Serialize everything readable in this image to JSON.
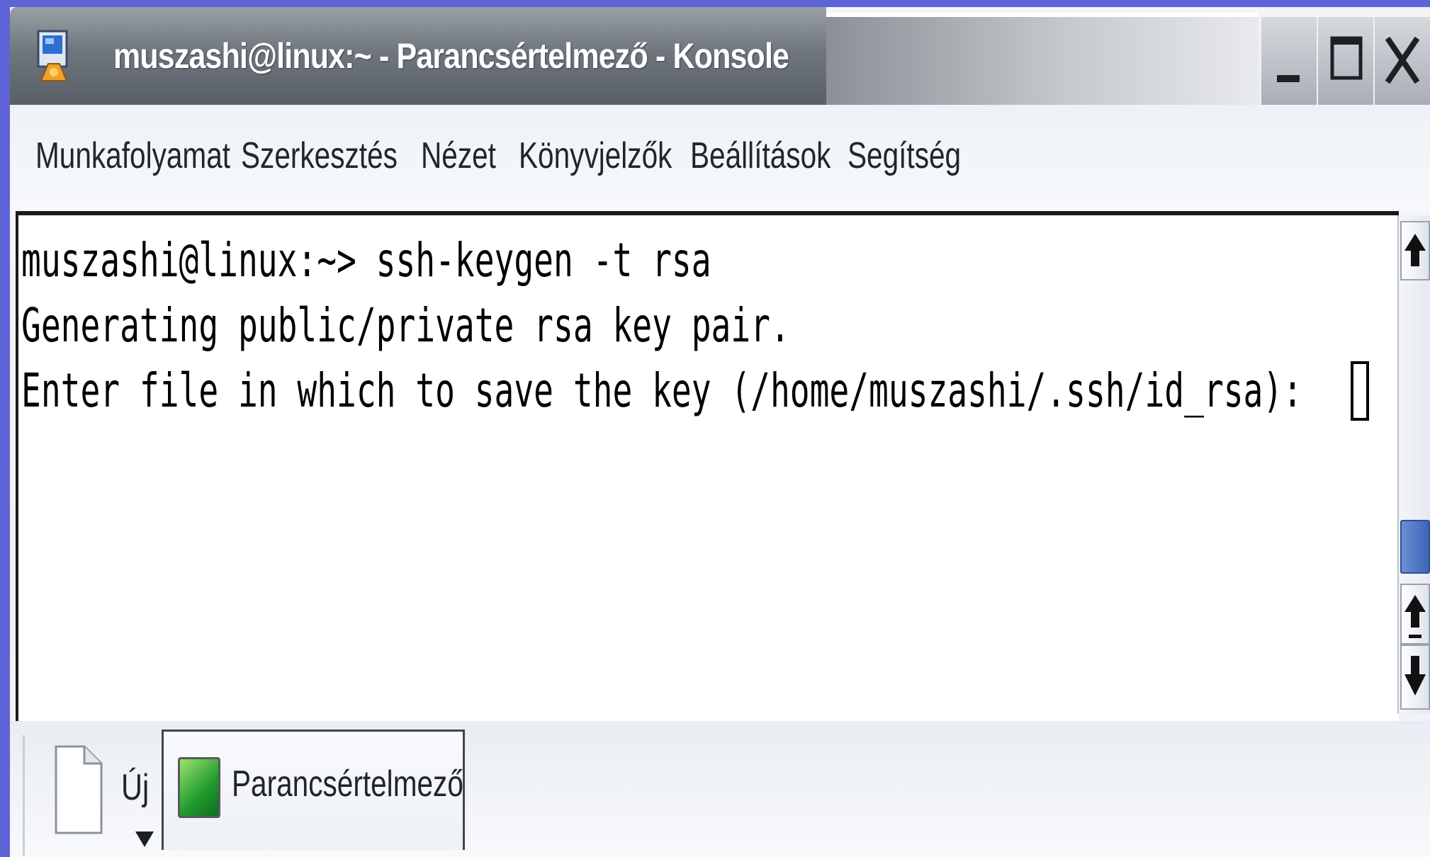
{
  "window": {
    "title": "muszashi@linux:~ - Parancsértelmező - Konsole"
  },
  "menu": {
    "items": [
      {
        "label": "Munkafolyamat"
      },
      {
        "label": "Szerkesztés"
      },
      {
        "label": "Nézet"
      },
      {
        "label": "Könyvjelzők"
      },
      {
        "label": "Beállítások"
      },
      {
        "label": "Segítség"
      }
    ]
  },
  "terminal": {
    "lines": [
      "muszashi@linux:~> ssh-keygen -t rsa",
      "Generating public/private rsa key pair.",
      "Enter file in which to save the key (/home/muszashi/.ssh/id_rsa): "
    ]
  },
  "tabs": {
    "new_label": "Új",
    "session_label": "Parancsértelmező"
  },
  "icons": {
    "app": "konsole-app-icon",
    "minimize": "minimize-icon",
    "maximize": "maximize-icon",
    "close": "close-icon",
    "new_session": "new-document-icon",
    "session": "terminal-icon"
  },
  "colors": {
    "desktop": "#5f63d8",
    "titlebar": "#6f767d",
    "scroll_thumb": "#3c66b9",
    "session_icon": "#1f9a2e"
  }
}
